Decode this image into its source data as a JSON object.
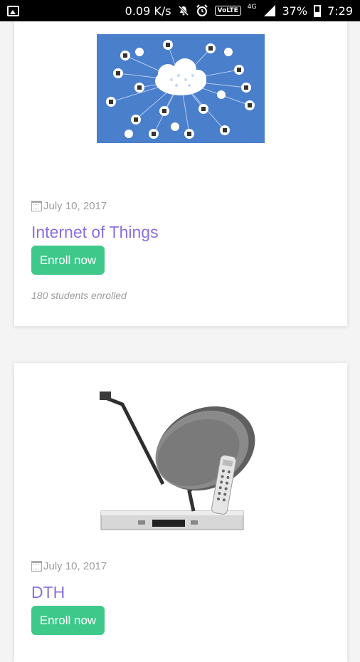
{
  "status_bar": {
    "speed": "0.09 K/s",
    "volte": "VoLTE",
    "network": "4G",
    "battery": "37%",
    "time": "7:29",
    "icons": [
      "gallery-icon",
      "mute-icon",
      "alarm-icon",
      "signal-icon",
      "battery-icon"
    ]
  },
  "courses": [
    {
      "date": "July 10, 2017",
      "title": "Internet of Things",
      "enroll_label": "Enroll now",
      "students": "180 students enrolled",
      "image": "iot-cloud-image"
    },
    {
      "date": "July 10, 2017",
      "title": "DTH",
      "enroll_label": "Enroll now",
      "image": "satellite-dish-image"
    }
  ],
  "colors": {
    "title": "#8b6fe0",
    "button": "#3ec98b",
    "iot_bg": "#4a7fcc"
  }
}
